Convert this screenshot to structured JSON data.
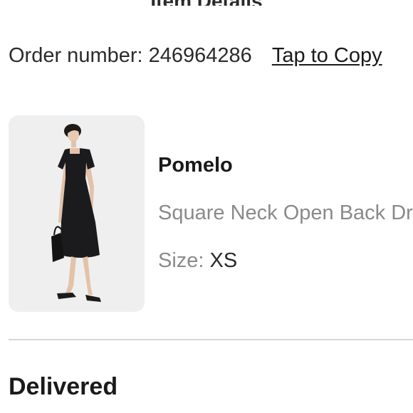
{
  "header": {
    "title": "Item Details"
  },
  "order": {
    "label": "Order number:",
    "number": "246964286",
    "copy_link": "Tap to Copy"
  },
  "item": {
    "brand": "Pomelo",
    "name": "Square Neck Open Back Dress",
    "size_label": "Size:",
    "size_value": "XS",
    "image_icon": "product-photo"
  },
  "status": {
    "text": "Delivered"
  }
}
